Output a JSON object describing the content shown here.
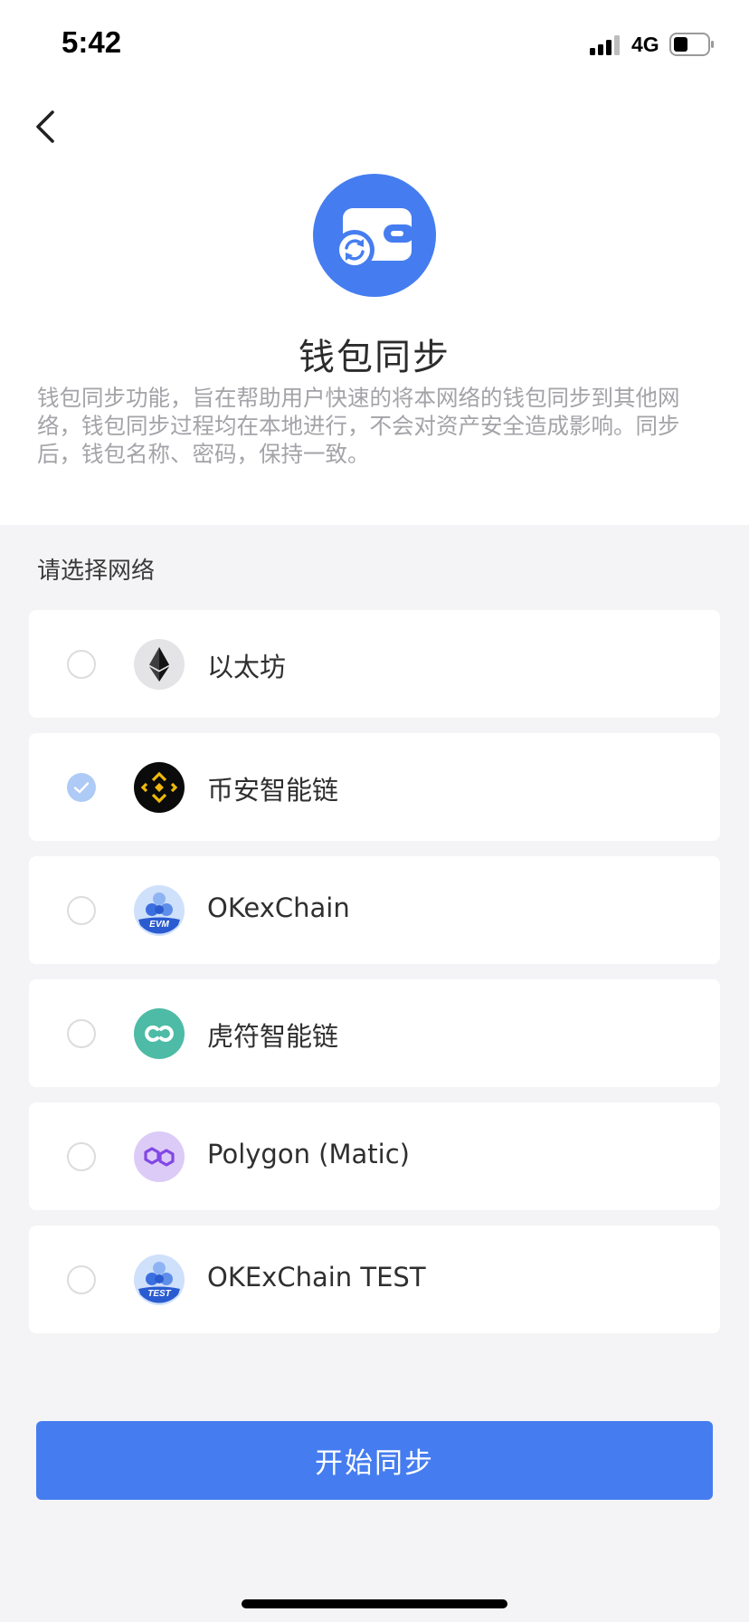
{
  "status_bar": {
    "time": "5:42",
    "network_type": "4G",
    "icons": [
      "signal-icon",
      "battery-icon"
    ]
  },
  "header": {
    "back_icon": "chevron-left-icon",
    "hero_icon": "wallet-sync-icon",
    "title": "钱包同步",
    "description": "钱包同步功能，旨在帮助用户快速的将本网络的钱包同步到其他网络，钱包同步过程均在本地进行，不会对资产安全造成影响。同步后，钱包名称、密码，保持一致。"
  },
  "network_section": {
    "label": "请选择网络",
    "items": [
      {
        "name": "以太坊",
        "icon": "ethereum-icon",
        "selected": false
      },
      {
        "name": "币安智能链",
        "icon": "binance-icon",
        "selected": true
      },
      {
        "name": "OKexChain",
        "icon": "okexchain-evm-icon",
        "selected": false
      },
      {
        "name": "虎符智能链",
        "icon": "hoo-icon",
        "selected": false
      },
      {
        "name": "Polygon (Matic)",
        "icon": "polygon-icon",
        "selected": false
      },
      {
        "name": "OKExChain TEST",
        "icon": "okexchain-test-icon",
        "selected": false
      }
    ]
  },
  "start_button": {
    "label": "开始同步"
  },
  "colors": {
    "accent": "#457df0",
    "radio_checked": "#aecaf6",
    "background": "#f4f4f6"
  }
}
